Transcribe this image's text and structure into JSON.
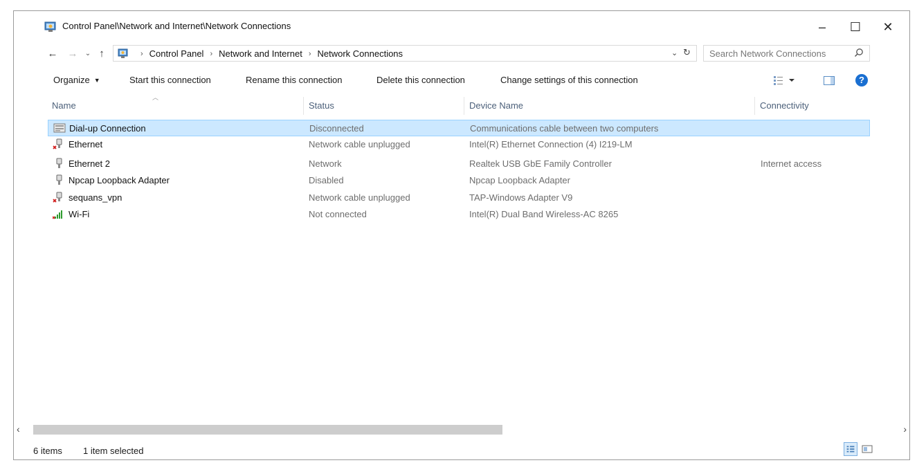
{
  "window": {
    "title": "Control Panel\\Network and Internet\\Network Connections",
    "controls": {
      "minimize": "–",
      "maximize": "☐",
      "close": "✕"
    }
  },
  "nav": {
    "back": "←",
    "forward": "→",
    "recent": "⌄",
    "up": "↑"
  },
  "address": {
    "breadcrumbs": [
      "Control Panel",
      "Network and Internet",
      "Network Connections"
    ],
    "separator": "›",
    "dropdown": "⌄",
    "refresh": "↻"
  },
  "search": {
    "placeholder": "Search Network Connections"
  },
  "toolbar": {
    "organize": "Organize",
    "start": "Start this connection",
    "rename": "Rename this connection",
    "delete": "Delete this connection",
    "change": "Change settings of this connection",
    "help": "?"
  },
  "columns": {
    "name": "Name",
    "status": "Status",
    "device": "Device Name",
    "connectivity": "Connectivity"
  },
  "connections": [
    {
      "name": "Dial-up Connection",
      "status": "Disconnected",
      "device": "Communications cable between two computers",
      "connectivity": "",
      "icon": "dialup-icon",
      "selected": true
    },
    {
      "name": "Ethernet",
      "status": "Network cable unplugged",
      "device": "Intel(R) Ethernet Connection (4) I219-LM",
      "connectivity": "",
      "icon": "ethernet-unplugged-icon",
      "selected": false
    },
    {
      "name": "Ethernet 2",
      "status": "Network",
      "device": "Realtek USB GbE Family Controller",
      "connectivity": "Internet access",
      "icon": "ethernet-icon",
      "selected": false
    },
    {
      "name": "Npcap Loopback Adapter",
      "status": "Disabled",
      "device": "Npcap Loopback Adapter",
      "connectivity": "",
      "icon": "ethernet-icon",
      "selected": false
    },
    {
      "name": "sequans_vpn",
      "status": "Network cable unplugged",
      "device": "TAP-Windows Adapter V9",
      "connectivity": "",
      "icon": "ethernet-unplugged-icon",
      "selected": false
    },
    {
      "name": "Wi-Fi",
      "status": "Not connected",
      "device": "Intel(R) Dual Band Wireless-AC 8265",
      "connectivity": "",
      "icon": "wifi-icon",
      "selected": false
    }
  ],
  "statusbar": {
    "count": "6 items",
    "selection": "1 item selected"
  },
  "colors": {
    "selection_bg": "#cce8ff",
    "selection_border": "#99d1ff",
    "header_text": "#4c607a",
    "help_blue": "#1a6fd1"
  }
}
